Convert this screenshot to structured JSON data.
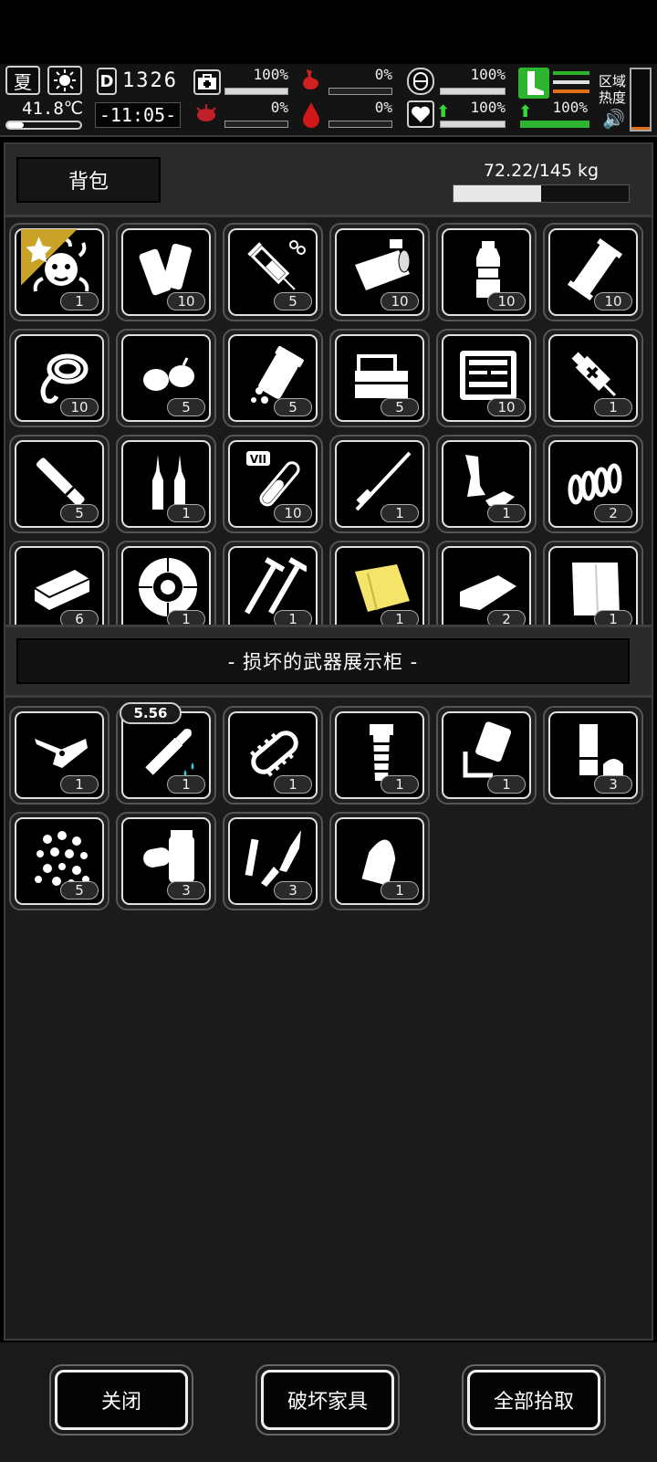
{
  "hud": {
    "season": "夏",
    "temperature": "41.8℃",
    "day": "1326",
    "time": "-11:05-",
    "area_heat_label_1": "区域",
    "area_heat_label_2": "热度",
    "stats": [
      {
        "name": "health",
        "value": "100%",
        "fill": 1.0
      },
      {
        "name": "hunger",
        "value": "0%",
        "fill": 0.0
      },
      {
        "name": "stamina",
        "value": "100%",
        "fill": 1.0
      },
      {
        "name": "infection",
        "value": "0%",
        "fill": 0.0
      },
      {
        "name": "bleeding",
        "value": "0%",
        "fill": 0.0
      },
      {
        "name": "mood",
        "value": "100%",
        "fill": 1.0
      },
      {
        "name": "movement",
        "value": "100%",
        "fill": 1.0
      }
    ]
  },
  "backpack": {
    "tab_label": "背包",
    "weight": "72.22/145 kg",
    "weight_fill": 0.498,
    "items": [
      {
        "icon": "medusa-icon",
        "count": "1",
        "starred": true
      },
      {
        "icon": "bandage-roll-icon",
        "count": "10"
      },
      {
        "icon": "syringe-icon",
        "count": "5"
      },
      {
        "icon": "canned-food-icon",
        "count": "10"
      },
      {
        "icon": "water-bottle-icon",
        "count": "10"
      },
      {
        "icon": "energy-bar-icon",
        "count": "10"
      },
      {
        "icon": "rope-icon",
        "count": "10"
      },
      {
        "icon": "seeds-icon",
        "count": "5"
      },
      {
        "icon": "pill-bottle-icon",
        "count": "5"
      },
      {
        "icon": "toolbox-icon",
        "count": "5"
      },
      {
        "icon": "repair-kit-icon",
        "count": "10"
      },
      {
        "icon": "adrenaline-syringe-icon",
        "count": "1"
      },
      {
        "icon": "cigarette-icon",
        "count": "5"
      },
      {
        "icon": "ampoule-icon",
        "count": "1"
      },
      {
        "icon": "test-tube-icon",
        "count": "10"
      },
      {
        "icon": "rod-icon",
        "count": "1"
      },
      {
        "icon": "metal-scrap-icon",
        "count": "1"
      },
      {
        "icon": "spring-icon",
        "count": "2"
      },
      {
        "icon": "whetstone-icon",
        "count": "6"
      },
      {
        "icon": "tire-icon",
        "count": "1"
      },
      {
        "icon": "screws-icon",
        "count": "1"
      },
      {
        "icon": "cloth-yellow-icon",
        "count": "1"
      },
      {
        "icon": "cloth-white-icon",
        "count": "2"
      },
      {
        "icon": "towel-icon",
        "count": "1"
      }
    ]
  },
  "container": {
    "title": "- 损坏的武器展示柜 -",
    "items": [
      {
        "icon": "folding-knife-icon",
        "count": "1"
      },
      {
        "icon": "bullet-icon",
        "count": "1",
        "caliber": "5.56"
      },
      {
        "icon": "chainsaw-blade-icon",
        "count": "1"
      },
      {
        "icon": "grip-icon",
        "count": "1"
      },
      {
        "icon": "trigger-part-icon",
        "count": "1"
      },
      {
        "icon": "shell-casing-icon",
        "count": "3"
      },
      {
        "icon": "pellets-icon",
        "count": "5"
      },
      {
        "icon": "pipe-parts-icon",
        "count": "3"
      },
      {
        "icon": "firing-pin-icon",
        "count": "3"
      },
      {
        "icon": "bullet-tip-icon",
        "count": "1"
      }
    ]
  },
  "footer": {
    "close": "关闭",
    "destroy": "破坏家具",
    "take_all": "全部拾取"
  }
}
